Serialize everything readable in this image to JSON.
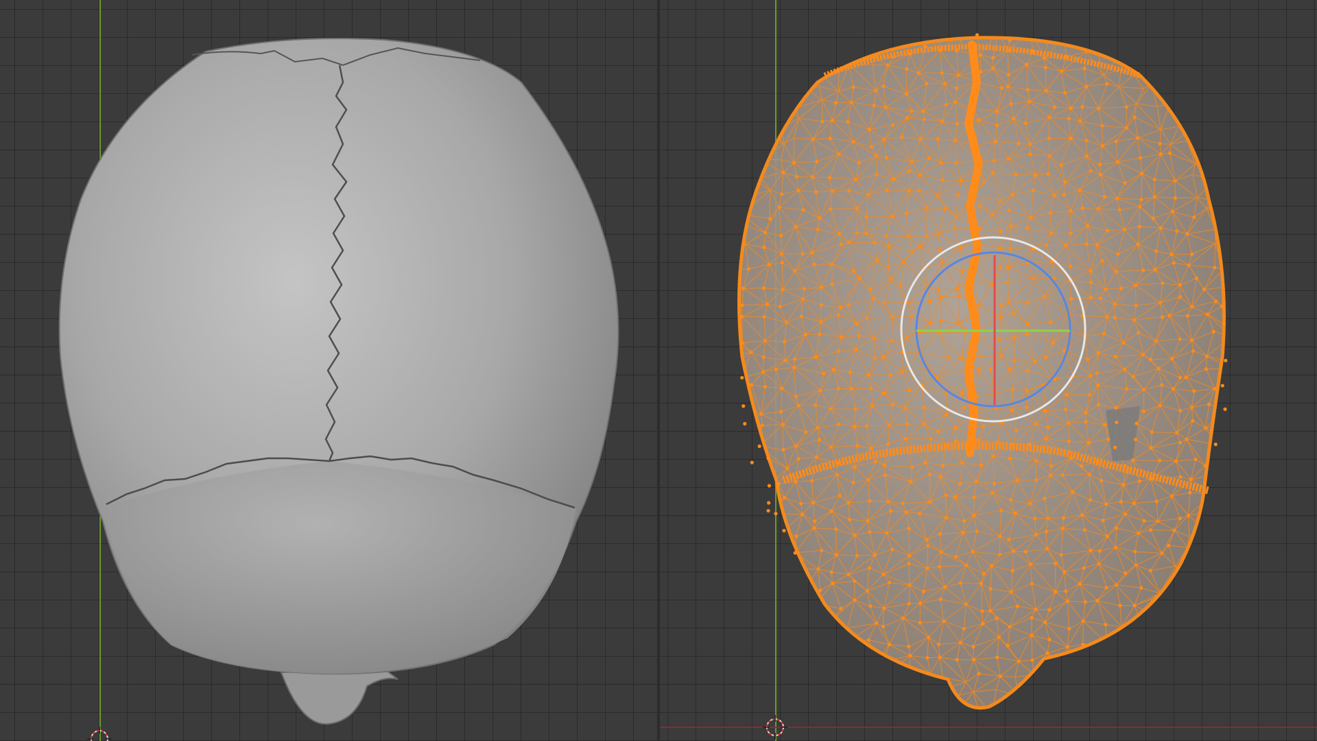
{
  "window": {
    "title": "",
    "layout": "split-viewport"
  },
  "viewports": [
    {
      "id": "left",
      "mode": "object-mode",
      "shading": "solid",
      "object": "skull-top-view",
      "show_wireframe": false
    },
    {
      "id": "right",
      "mode": "edit-mode",
      "shading": "x-ray-wireframe",
      "object": "skull-top-view",
      "show_wireframe": true,
      "selected_all": true,
      "gizmo": "rotate"
    }
  ],
  "colors": {
    "grid_background": "#3b3b3b",
    "grid_line": "#2f2f2f",
    "axis_y": "#6c9a2a",
    "axis_x": "#8a2a35",
    "mesh_solid": "#a9a9a9",
    "selection_orange": "#f48a1c",
    "vertex_orange": "#ff8c1a",
    "gizmo_blue": "#5a86e0",
    "gizmo_white": "#e8e8e8",
    "gizmo_green": "#8fd24a",
    "gizmo_red": "#e64a4a"
  },
  "icons": {
    "cursor": "3d-cursor-icon",
    "rotate_gizmo": "rotate-gizmo-icon"
  }
}
